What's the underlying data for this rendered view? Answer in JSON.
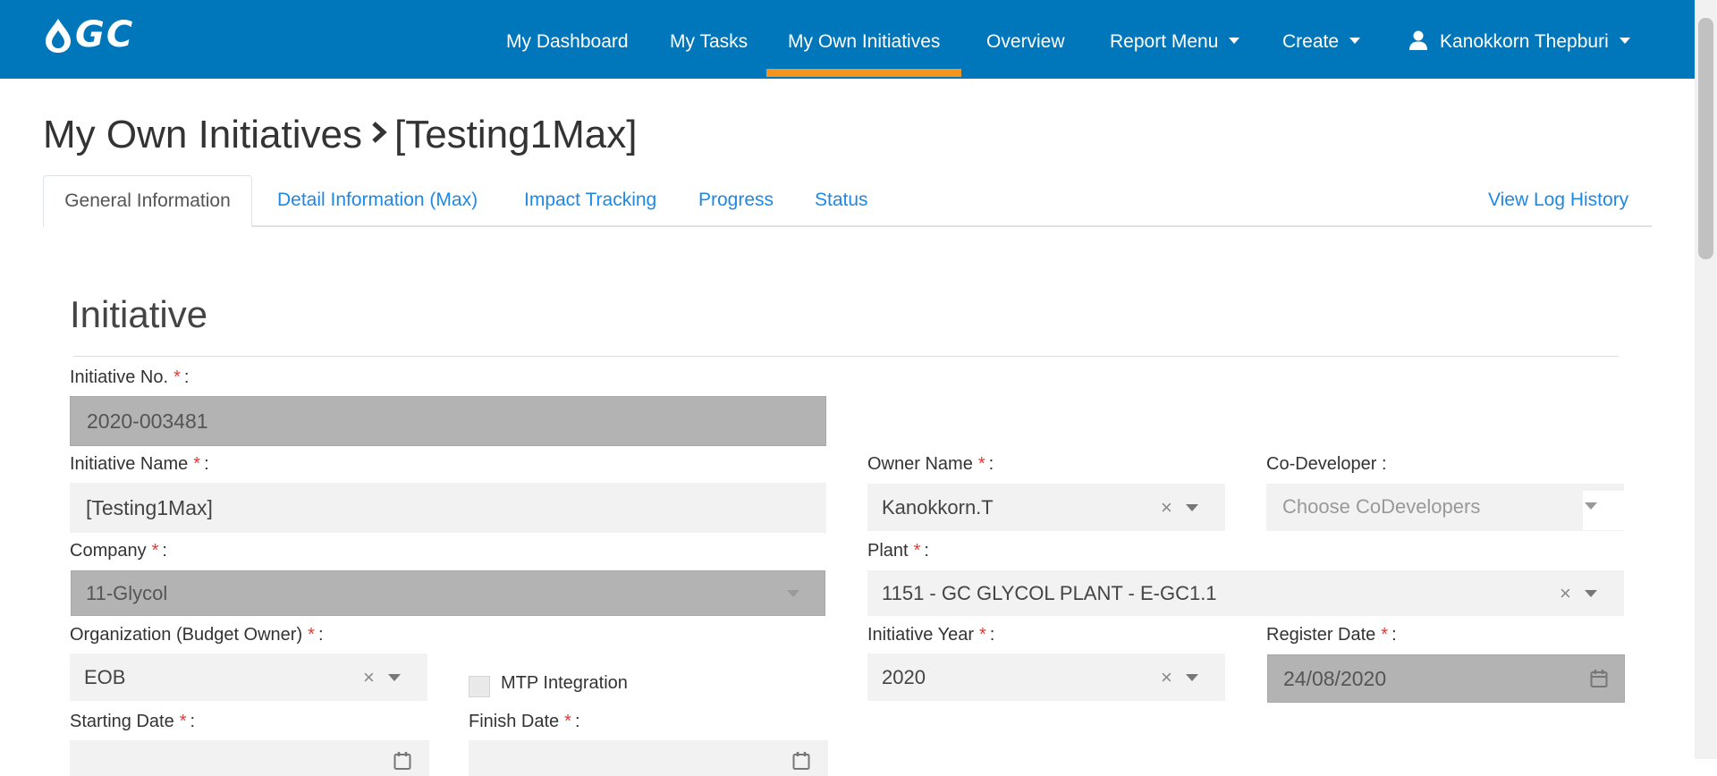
{
  "brand": {
    "logo_text": "GC",
    "nav_bg": "#0076bb",
    "accent": "#f7941d",
    "link": "#1e88e5"
  },
  "nav": {
    "items": [
      {
        "label": "My Dashboard"
      },
      {
        "label": "My Tasks"
      },
      {
        "label": "My Own Initiatives"
      },
      {
        "label": "Overview"
      },
      {
        "label": "Report Menu"
      },
      {
        "label": "Create"
      }
    ],
    "active": "My Own Initiatives",
    "user_name": "Kanokkorn Thepburi"
  },
  "page": {
    "breadcrumb_root": "My Own Initiatives",
    "breadcrumb_current": "[Testing1Max]"
  },
  "tabs": {
    "items": [
      {
        "label": "General Information"
      },
      {
        "label": "Detail Information (Max)"
      },
      {
        "label": "Impact Tracking"
      },
      {
        "label": "Progress"
      },
      {
        "label": "Status"
      }
    ],
    "active": "General Information",
    "log_history": "View Log History"
  },
  "section": {
    "title": "Initiative"
  },
  "form": {
    "initiative_no": {
      "label": "Initiative No.",
      "value": "2020-003481"
    },
    "initiative_name": {
      "label": "Initiative Name",
      "value": "[Testing1Max]"
    },
    "owner_name": {
      "label": "Owner Name",
      "value": "Kanokkorn.T"
    },
    "co_developer": {
      "label": "Co-Developer :",
      "placeholder": "Choose CoDevelopers"
    },
    "company": {
      "label": "Company",
      "value": "11-Glycol"
    },
    "plant": {
      "label": "Plant",
      "value": "1151 - GC GLYCOL PLANT - E-GC1.1"
    },
    "organization": {
      "label": "Organization (Budget Owner)",
      "value": "EOB"
    },
    "mtp_integration": {
      "label": "MTP Integration",
      "checked": false
    },
    "initiative_year": {
      "label": "Initiative Year",
      "value": "2020"
    },
    "register_date": {
      "label": "Register Date",
      "value": "24/08/2020"
    },
    "starting_date": {
      "label": "Starting Date"
    },
    "finish_date": {
      "label": "Finish Date"
    },
    "required_mark": "*",
    "colon": ":"
  }
}
